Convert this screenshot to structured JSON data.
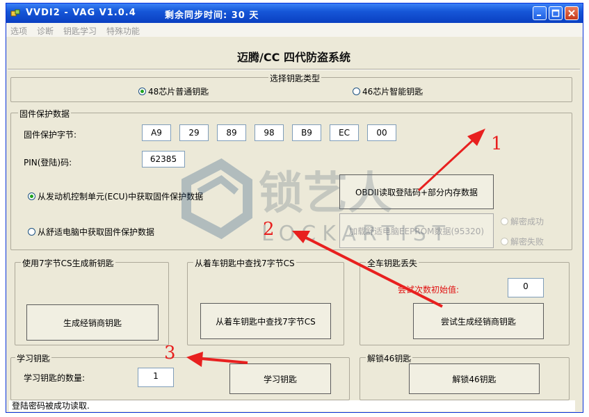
{
  "window": {
    "title": "VVDI2 - VAG V1.0.4",
    "sync_label": "剩余同步时间: 30 天"
  },
  "menu": [
    "选项",
    "诊断",
    "钥匙学习",
    "特殊功能"
  ],
  "main_title": "迈腾/CC 四代防盗系统",
  "key_type": {
    "label": "选择钥匙类型",
    "options": [
      "48芯片普通钥匙",
      "46芯片智能钥匙"
    ],
    "selected": "48芯片普通钥匙"
  },
  "protect": {
    "label": "固件保护数据",
    "bytes_label": "固件保护字节:",
    "bytes": [
      "A9",
      "29",
      "89",
      "98",
      "B9",
      "EC",
      "00"
    ],
    "pin_label": "PIN(登陆)码:",
    "pin_value": "62385",
    "source_ecu": "从发动机控制单元(ECU)中获取固件保护数据",
    "source_comfort": "从舒适电脑中获取固件保护数据",
    "obd_button": "OBDII读取登陆码+部分内存数据",
    "eeprom_button": "加载舒适电脑EEPROM数据(95320)",
    "decrypt_ok": "解密成功",
    "decrypt_fail": "解密失败"
  },
  "cs_new": {
    "label": "使用7字节CS生成新钥匙",
    "button": "生成经销商钥匙"
  },
  "cs_find": {
    "label": "从着车钥匙中查找7字节CS",
    "button": "从着车钥匙中查找7字节CS"
  },
  "all_lost": {
    "label": "全车钥匙丢失",
    "try_label": "尝试次数初始值:",
    "try_value": "0",
    "button": "尝试生成经销商钥匙"
  },
  "learn": {
    "label": "学习钥匙",
    "count_label": "学习钥匙的数量:",
    "count_value": "1",
    "button": "学习钥匙"
  },
  "unlock46": {
    "label": "解锁46钥匙",
    "button": "解锁46钥匙"
  },
  "status": "登陆密码被成功读取.",
  "annotations": [
    "1",
    "2",
    "3"
  ],
  "watermark": {
    "cn": "锁艺人",
    "en": "LOCKARTIST"
  },
  "colors": {
    "annotation": "#e8201f",
    "title_bar": "#0a54e3",
    "dialog_bg": "#ece9d8"
  }
}
